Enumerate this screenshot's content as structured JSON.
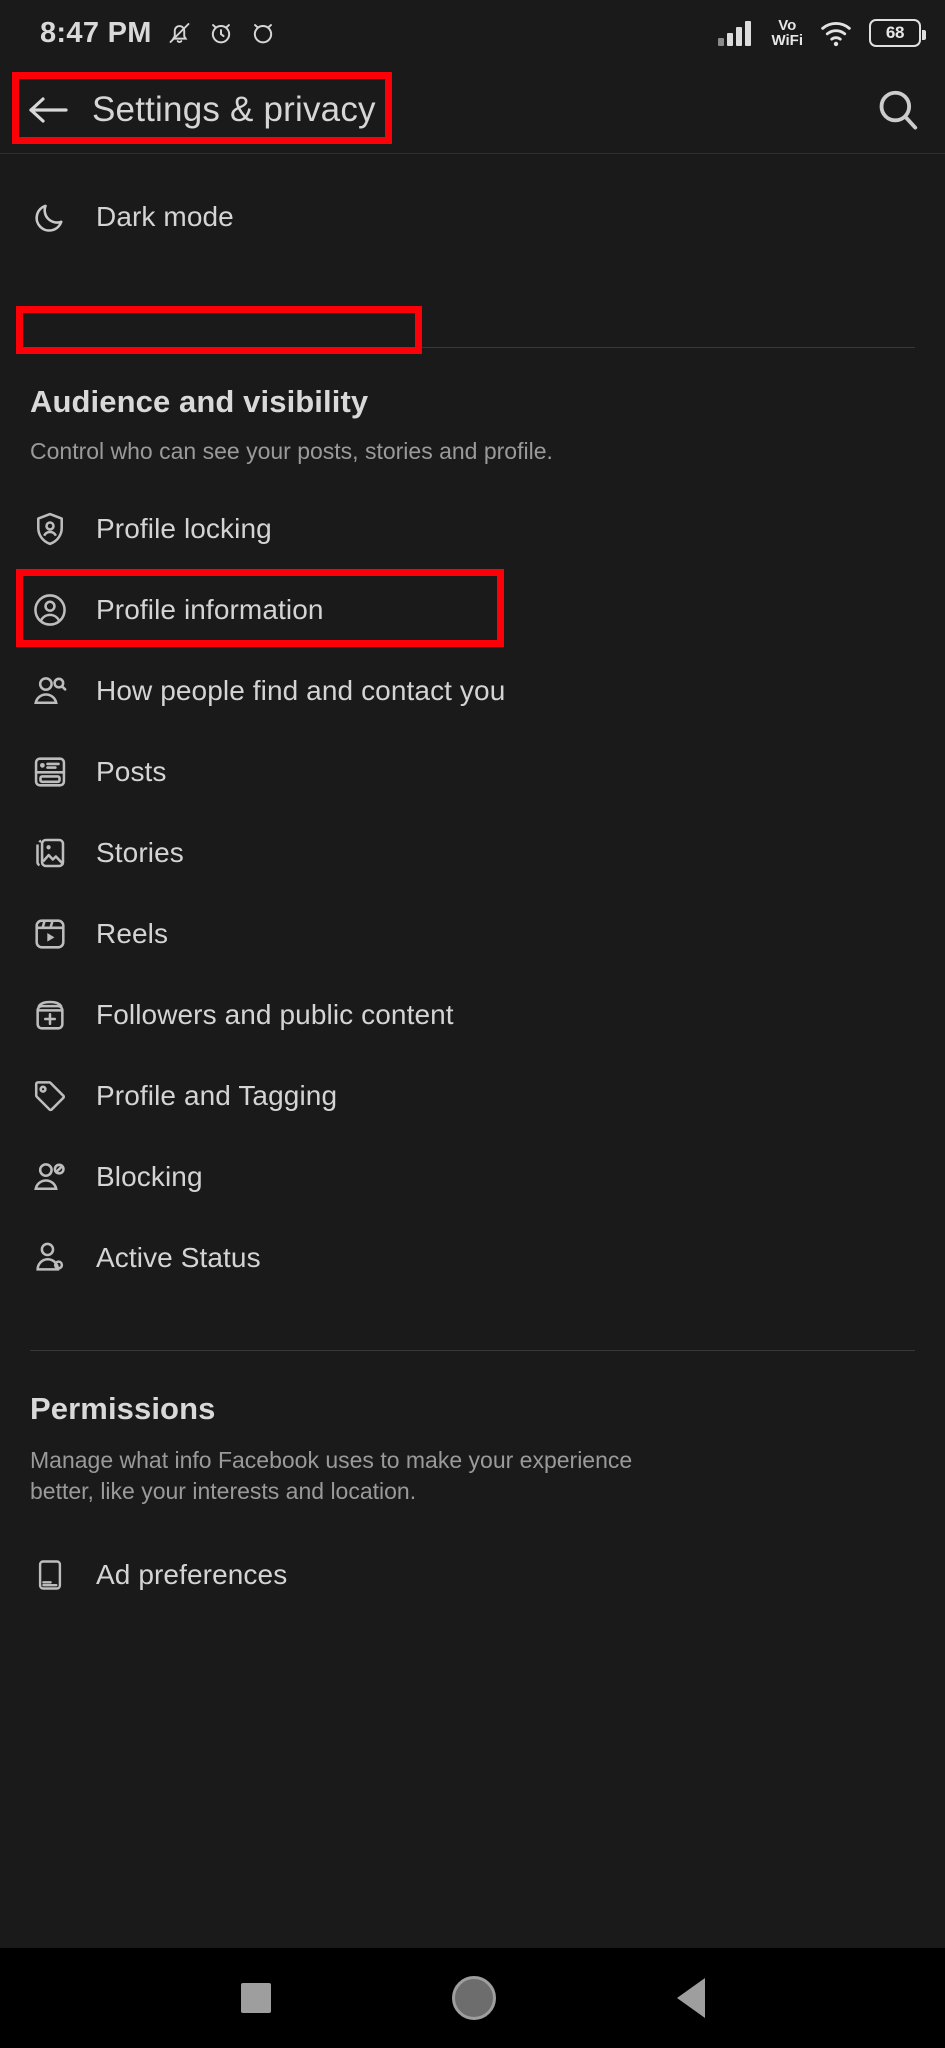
{
  "statusbar": {
    "time": "8:47 PM",
    "icons_left": [
      "bell-muted-icon",
      "alarm-clock-icon",
      "alarm-clock-outline-icon"
    ],
    "network_label_line1": "Vo",
    "network_label_line2": "WiFi",
    "icons_right": [
      "signal-bars-icon",
      "vowifi-label",
      "wifi-icon",
      "battery-icon"
    ],
    "battery_percent": "68"
  },
  "appbar": {
    "back_icon": "back-arrow-icon",
    "title": "Settings & privacy",
    "search_icon": "search-icon"
  },
  "dark_mode": {
    "icon": "moon-icon",
    "label": "Dark mode"
  },
  "sections": [
    {
      "id": "audience-and-visibility",
      "title": "Audience and visibility",
      "subtitle": "Control who can see your posts, stories and profile.",
      "items": [
        {
          "label": "Profile locking",
          "icon": "shield-person-icon"
        },
        {
          "label": "Profile information",
          "icon": "profile-circle-icon"
        },
        {
          "label": "How people find and contact you",
          "icon": "person-search-icon"
        },
        {
          "label": "Posts",
          "icon": "post-card-icon"
        },
        {
          "label": "Stories",
          "icon": "stories-image-icon"
        },
        {
          "label": "Reels",
          "icon": "reels-play-icon"
        },
        {
          "label": "Followers and public content",
          "icon": "followers-plus-icon"
        },
        {
          "label": "Profile and Tagging",
          "icon": "tag-icon"
        },
        {
          "label": "Blocking",
          "icon": "person-block-icon"
        },
        {
          "label": "Active Status",
          "icon": "person-active-icon"
        }
      ]
    },
    {
      "id": "permissions",
      "title": "Permissions",
      "subtitle": "Manage what info Facebook uses to make your experience better, like your interests and location.",
      "items": [
        {
          "label": "Ad preferences",
          "icon": "mobile-device-icon"
        }
      ]
    }
  ],
  "highlights": [
    {
      "target": "appbar",
      "color": "#fb0007"
    },
    {
      "target": "audience-title",
      "color": "#fb0007"
    },
    {
      "target": "how-people-row",
      "color": "#fb0007"
    }
  ],
  "navbar": {
    "recents_icon": "square-recents-icon",
    "home_icon": "circle-home-icon",
    "back_icon": "triangle-back-icon"
  }
}
